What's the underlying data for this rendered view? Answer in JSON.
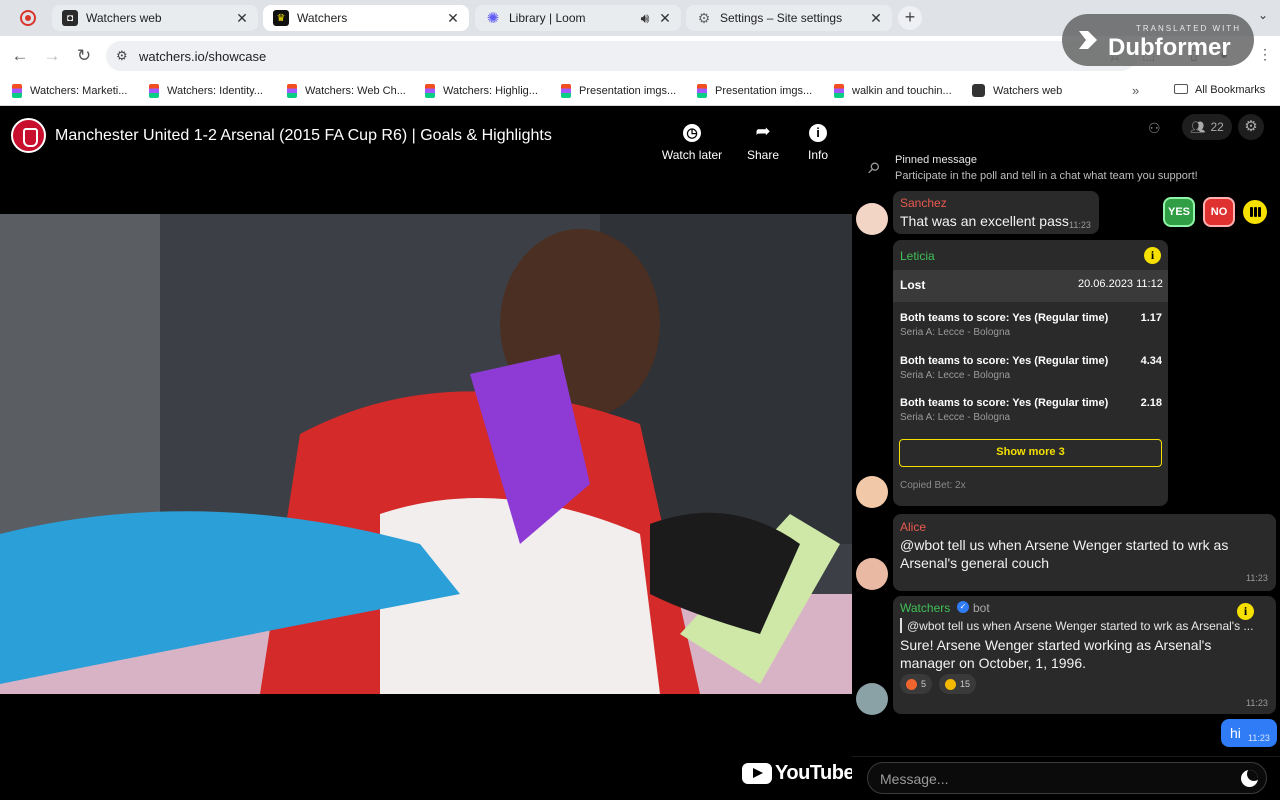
{
  "browser": {
    "tabs": [
      {
        "title": "Watchers web",
        "icon": "watchers-chat-icon"
      },
      {
        "title": "Watchers",
        "icon": "watchers-crown-icon"
      },
      {
        "title": "Library | Loom",
        "icon": "loom-icon"
      },
      {
        "title": "Settings – Site settings",
        "icon": "gear-icon"
      }
    ],
    "url": "watchers.io/showcase",
    "bookmarks": [
      "Watchers: Marketi...",
      "Watchers: Identity...",
      "Watchers: Web Ch...",
      "Watchers: Highlig...",
      "Presentation imgs...",
      "Presentation imgs...",
      "walkin and touchin...",
      "Watchers web"
    ],
    "all_bookmarks": "All Bookmarks"
  },
  "overlay": {
    "small": "TRANSLATED WITH",
    "brand": "Dubformer"
  },
  "video": {
    "title": "Manchester United 1-2 Arsenal (2015 FA Cup R6) | Goals & Highlights",
    "actions": {
      "watch_later": "Watch later",
      "share": "Share",
      "info": "Info"
    },
    "platform": "YouTube"
  },
  "chat": {
    "viewer_count": "22",
    "pinned": {
      "title": "Pinned message",
      "text": "Participate in the poll and tell in a chat what team you support!"
    },
    "poll": {
      "yes": "YES",
      "no": "NO"
    },
    "messages": {
      "sanchez": {
        "name": "Sanchez",
        "text": "That was an excellent pass",
        "time": "11:23",
        "name_color": "#e85a4f"
      },
      "leticia": {
        "name": "Leticia",
        "name_color": "#40c057",
        "bet": {
          "status": "Lost",
          "date": "20.06.2023 11:12",
          "items": [
            {
              "title": "Both teams to score: Yes (Regular time)",
              "match": "Seria A: Lecce - Bologna",
              "odd": "1.17"
            },
            {
              "title": "Both teams to score: Yes (Regular time)",
              "match": "Seria A: Lecce - Bologna",
              "odd": "4.34"
            },
            {
              "title": "Both teams to score: Yes (Regular time)",
              "match": "Seria A: Lecce - Bologna",
              "odd": "2.18"
            }
          ],
          "show_more": "Show more 3",
          "copied": "Copied Bet: 2x"
        }
      },
      "alice": {
        "name": "Alice",
        "text": "@wbot tell us when Arsene Wenger started to wrk as Arsenal's general couch",
        "time": "11:23",
        "name_color": "#e85a4f"
      },
      "watchers": {
        "name": "Watchers",
        "badge": "bot",
        "name_color": "#40c057",
        "quote": "@wbot tell us when Arsene Wenger started to wrk as Arsenal's ...",
        "text": "Sure! Arsene Wenger started working as Arsenal's manager on October, 1, 1996.",
        "reactions": [
          {
            "emoji": "angry-face",
            "count": "5"
          },
          {
            "emoji": "star-eyes-face",
            "count": "15"
          }
        ],
        "time": "11:23"
      },
      "me": {
        "text": "hi",
        "time": "11:23"
      }
    },
    "composer_placeholder": "Message..."
  }
}
